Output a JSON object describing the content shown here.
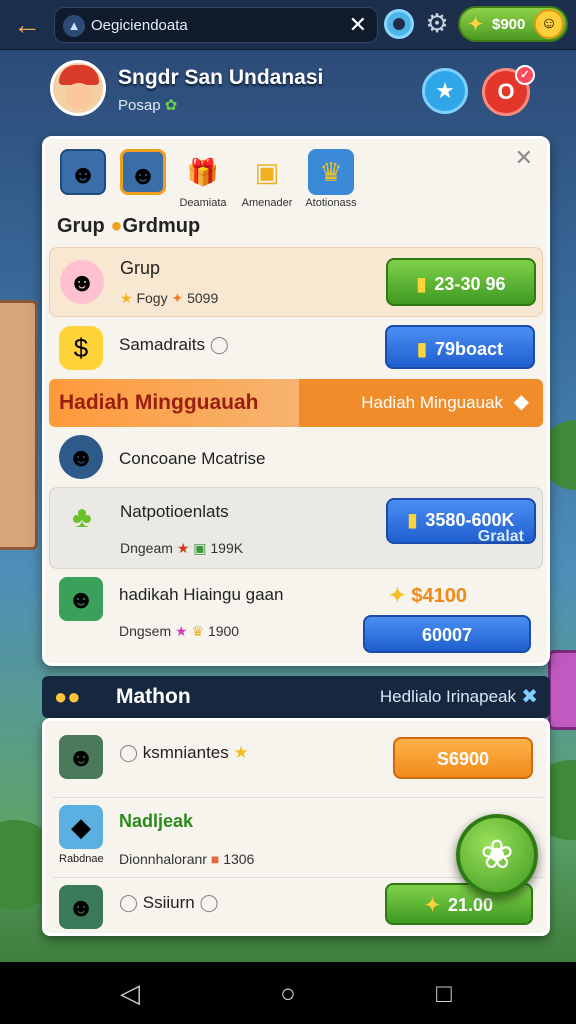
{
  "topbar": {
    "search_text": "Oegiciendoata",
    "coins": "$900"
  },
  "profile": {
    "name": "Sngdr San Undanasi",
    "subtitle": "Posap"
  },
  "tabs": [
    {
      "label": ""
    },
    {
      "label": ""
    },
    {
      "label": "Deamiata"
    },
    {
      "label": "Amenader"
    },
    {
      "label": "Atotionass"
    }
  ],
  "section_title": "Grup",
  "section_title_2": "Grdmup",
  "rows": {
    "r1": {
      "title": "Grup",
      "sub_a": "Fogy",
      "sub_b": "5099",
      "button": "23-30 96"
    },
    "r2": {
      "title": "Samadraits",
      "button": "79boact"
    },
    "banner": {
      "left": "Hadiah Mingguauah",
      "right": "Hadiah Minguauak"
    },
    "r3": {
      "title": "Concoane Mcatrise"
    },
    "r4": {
      "title": "Natpotioenlats",
      "sub_a": "Dngeam",
      "sub_b": "199K",
      "button": "3580-600K",
      "button_sub": "Gralat"
    },
    "r5": {
      "title": "hadikah Hiaingu gaan",
      "sub_a": "Dngsem",
      "sub_b": "1900",
      "price": "$4100",
      "button": "60007"
    }
  },
  "missions": {
    "header": "Mathon",
    "header_right": "Hedlialo Irinapeak",
    "m1": {
      "title": "ksmniantes",
      "button": "S6900"
    },
    "m2": {
      "title": "Nadljeak",
      "label": "Rabdnae",
      "sub": "Dionnhaloranr",
      "sub_b": "1306"
    },
    "m3": {
      "title": "Ssiiurn",
      "button": "21.00"
    }
  },
  "colors": {
    "accent_green": "#4d9a22",
    "accent_blue": "#1f5fd0",
    "accent_orange": "#f08a1a"
  }
}
